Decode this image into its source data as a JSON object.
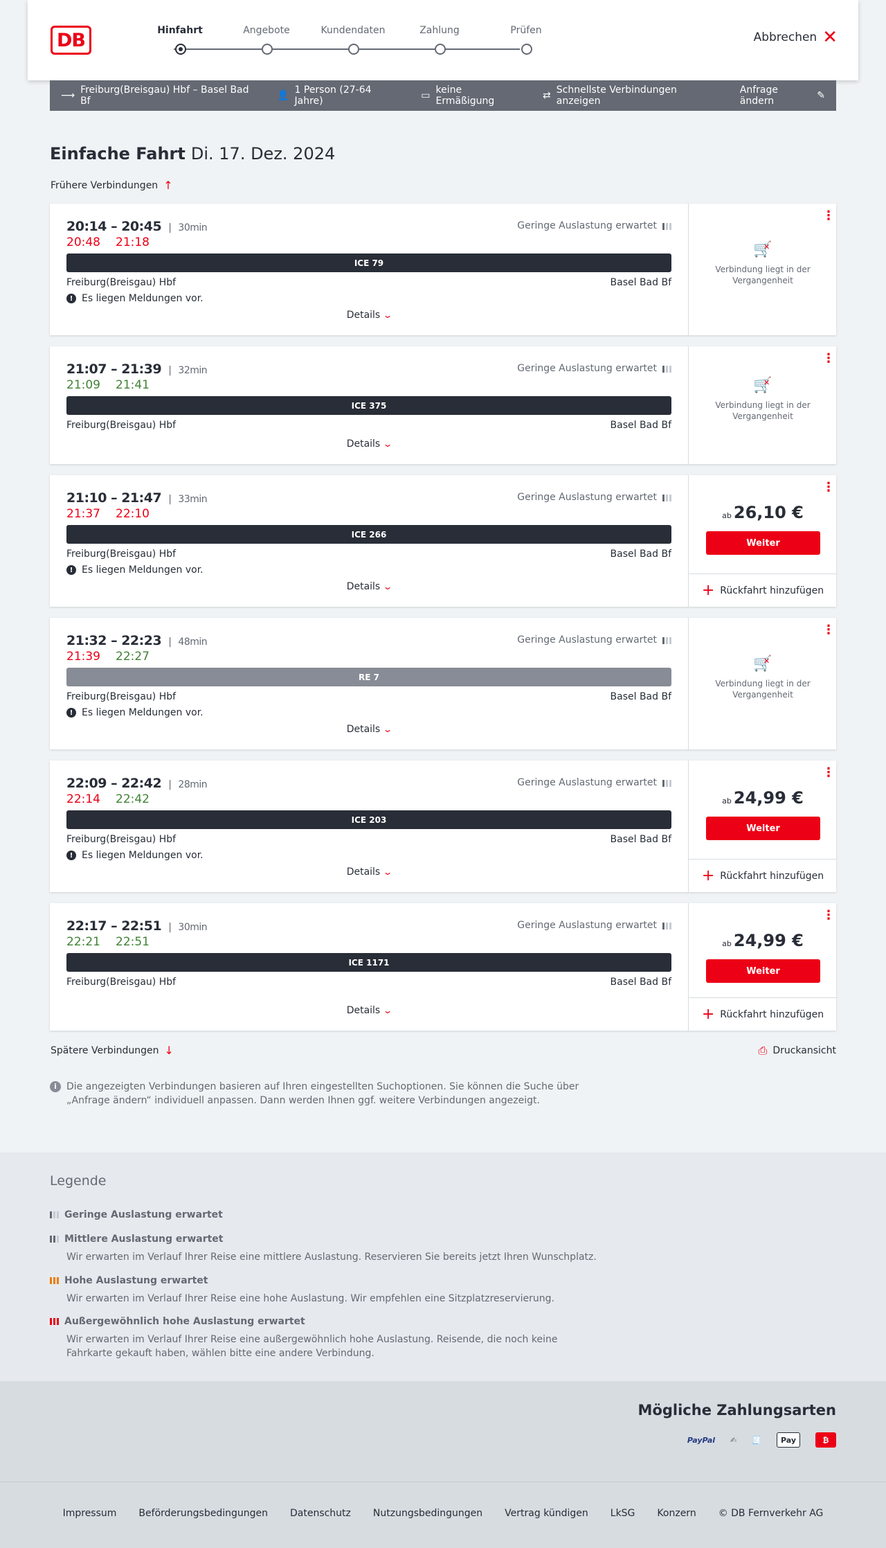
{
  "header": {
    "logo": "DB",
    "steps": [
      "Hinfahrt",
      "Angebote",
      "Kundendaten",
      "Zahlung",
      "Prüfen"
    ],
    "active_step": 0,
    "cancel_label": "Abbrechen"
  },
  "search": {
    "route": "Freiburg(Breisgau) Hbf – Basel Bad Bf",
    "passengers": "1 Person (27-64 Jahre)",
    "discount": "keine Ermäßigung",
    "fastest": "Schnellste Verbindungen anzeigen",
    "edit": "Anfrage ändern"
  },
  "title": {
    "kind": "Einfache Fahrt",
    "date": "Di. 17. Dez. 2024"
  },
  "earlier_label": "Frühere Verbindungen",
  "later_label": "Spätere Verbindungen",
  "print_label": "Druckansicht",
  "load_label": "Geringe Auslastung erwartet",
  "details_label": "Details",
  "note_label": "Es liegen Meldungen vor.",
  "past_label": "Verbindung liegt in der Vergangenheit",
  "price_prefix": "ab",
  "weiter_label": "Weiter",
  "return_label": "Rückfahrt hinzufügen",
  "connections": [
    {
      "times": "20:14 – 20:45",
      "duration": "30min",
      "rt_dep": "20:48",
      "rt_arr": "21:18",
      "dep_status": "late",
      "arr_status": "late",
      "train": "ICE 79",
      "from": "Freiburg(Breisgau) Hbf",
      "to": "Basel Bad Bf",
      "note": true,
      "price": null
    },
    {
      "times": "21:07 – 21:39",
      "duration": "32min",
      "rt_dep": "21:09",
      "rt_arr": "21:41",
      "dep_status": "ontime",
      "arr_status": "ontime",
      "train": "ICE 375",
      "from": "Freiburg(Breisgau) Hbf",
      "to": "Basel Bad Bf",
      "note": false,
      "price": null
    },
    {
      "times": "21:10 – 21:47",
      "duration": "33min",
      "rt_dep": "21:37",
      "rt_arr": "22:10",
      "dep_status": "late",
      "arr_status": "late",
      "train": "ICE 266",
      "from": "Freiburg(Breisgau) Hbf",
      "to": "Basel Bad Bf",
      "note": true,
      "price": "26,10 €"
    },
    {
      "times": "21:32 – 22:23",
      "duration": "48min",
      "rt_dep": "21:39",
      "rt_arr": "22:27",
      "dep_status": "late",
      "arr_status": "ontime",
      "train": "RE 7",
      "from": "Freiburg(Breisgau) Hbf",
      "to": "Basel Bad Bf",
      "note": true,
      "price": null
    },
    {
      "times": "22:09 – 22:42",
      "duration": "28min",
      "rt_dep": "22:14",
      "rt_arr": "22:42",
      "dep_status": "late",
      "arr_status": "ontime",
      "train": "ICE 203",
      "from": "Freiburg(Breisgau) Hbf",
      "to": "Basel Bad Bf",
      "note": true,
      "price": "24,99 €"
    },
    {
      "times": "22:17 – 22:51",
      "duration": "30min",
      "rt_dep": "22:21",
      "rt_arr": "22:51",
      "dep_status": "ontime",
      "arr_status": "ontime",
      "train": "ICE 1171",
      "from": "Freiburg(Breisgau) Hbf",
      "to": "Basel Bad Bf",
      "note": false,
      "price": "24,99 €"
    }
  ],
  "info_text": "Die angezeigten Verbindungen basieren auf Ihren eingestellten Suchoptionen. Sie können die Suche über „Anfrage ändern“ individuell anpassen. Dann werden Ihnen ggf. weitere Verbindungen angezeigt.",
  "legend": {
    "title": "Legende",
    "items": [
      {
        "title": "Geringe Auslastung erwartet",
        "desc": ""
      },
      {
        "title": "Mittlere Auslastung erwartet",
        "desc": "Wir erwarten im Verlauf Ihrer Reise eine mittlere Auslastung. Reservieren Sie bereits jetzt Ihren Wunschplatz."
      },
      {
        "title": "Hohe Auslastung erwartet",
        "desc": "Wir erwarten im Verlauf Ihrer Reise eine hohe Auslastung. Wir empfehlen eine Sitzplatzreservierung."
      },
      {
        "title": "Außergewöhnlich hohe Auslastung erwartet",
        "desc": "Wir erwarten im Verlauf Ihrer Reise eine außergewöhnlich hohe Auslastung. Reisende, die noch keine Fahrkarte gekauft haben, wählen bitte eine andere Verbindung."
      }
    ]
  },
  "payment": {
    "title": "Mögliche Zahlungsarten",
    "methods": [
      "PayPal",
      "Pay"
    ]
  },
  "footer": {
    "links": [
      "Impressum",
      "Beförderungsbedingungen",
      "Datenschutz",
      "Nutzungsbedingungen",
      "Vertrag kündigen",
      "LkSG",
      "Konzern",
      "© DB Fernverkehr AG"
    ]
  },
  "colors": {
    "brand_red": "#ec0016",
    "on_time_green": "#408335",
    "dark": "#282d37",
    "grey": "#646973"
  }
}
